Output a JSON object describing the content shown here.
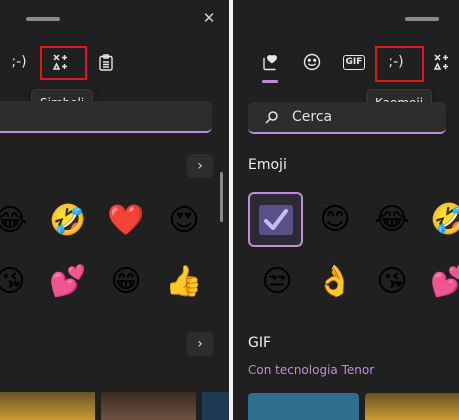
{
  "left": {
    "tabs": {
      "kaomoji_text": ";-)",
      "symbols_icon": "symbols-icon",
      "clipboard_icon": "clipboard-icon"
    },
    "tooltip": "Simboli",
    "close_glyph": "✕",
    "nav_glyph": "›",
    "emoji_row1": [
      "😂",
      "🤣",
      "❤️",
      "😍"
    ],
    "emoji_row2": [
      "😘",
      "💕",
      "😁",
      "👍"
    ]
  },
  "right": {
    "tabs": {
      "favorites_icon": "heart-note-icon",
      "emoji_icon": "smiley-icon",
      "gif_text": "GIF",
      "kaomoji_text": ";-)",
      "symbols_icon": "symbols-icon"
    },
    "tooltip": "Kaomoji",
    "search": {
      "icon": "search-icon",
      "placeholder": "Cerca"
    },
    "emoji_section": "Emoji",
    "emoji_row1": [
      "✔️",
      "😊",
      "😂",
      "🤣"
    ],
    "emoji_row2": [
      "😒",
      "👌",
      "😘",
      "💕"
    ],
    "gif_section": "GIF",
    "gif_powered": "Con tecnologia Tenor"
  },
  "colors": {
    "accent": "#c18bd9",
    "highlight": "#e0161a",
    "panel": "#202020"
  }
}
